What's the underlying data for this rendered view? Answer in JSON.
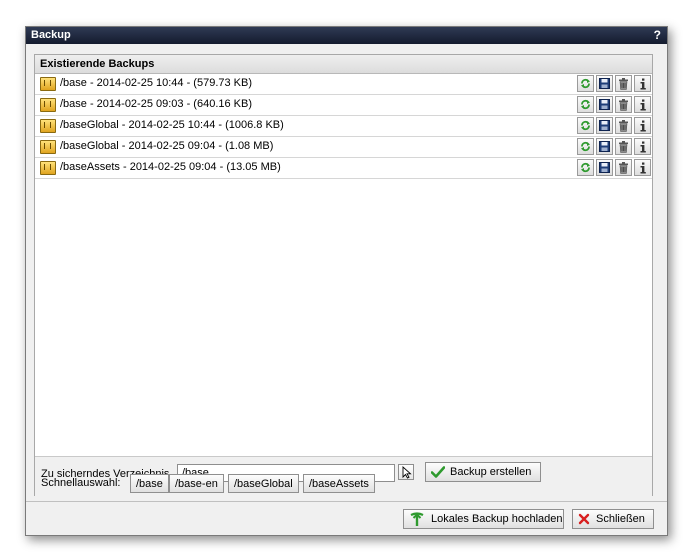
{
  "dialog": {
    "title": "Backup",
    "help_glyph": "?"
  },
  "backups": {
    "header": "Existierende Backups",
    "items": [
      {
        "label": "/base - 2014-02-25 10:44 - (579.73 KB)"
      },
      {
        "label": "/base - 2014-02-25 09:03 - (640.16 KB)"
      },
      {
        "label": "/baseGlobal - 2014-02-25 10:44 - (1006.8 KB)"
      },
      {
        "label": "/baseGlobal - 2014-02-25 09:04 - (1.08 MB)"
      },
      {
        "label": "/baseAssets - 2014-02-25 09:04 - (13.05 MB)"
      }
    ],
    "row_actions": [
      "restore-icon",
      "save-icon",
      "delete-icon",
      "info-icon"
    ]
  },
  "form": {
    "dir_label": "Zu sicherndes Verzeichnis",
    "dir_value": "/base",
    "create_button": "Backup erstellen",
    "quick_label": "Schnellauswahl:",
    "quick_options": [
      "/base",
      "/base-en",
      "/baseGlobal",
      "/baseAssets"
    ]
  },
  "footer": {
    "upload_button": "Lokales Backup hochladen",
    "close_button": "Schließen"
  },
  "colors": {
    "titlebar": "#1f273b",
    "accent_green": "#2e9a2e",
    "close_red": "#d81f1f"
  }
}
